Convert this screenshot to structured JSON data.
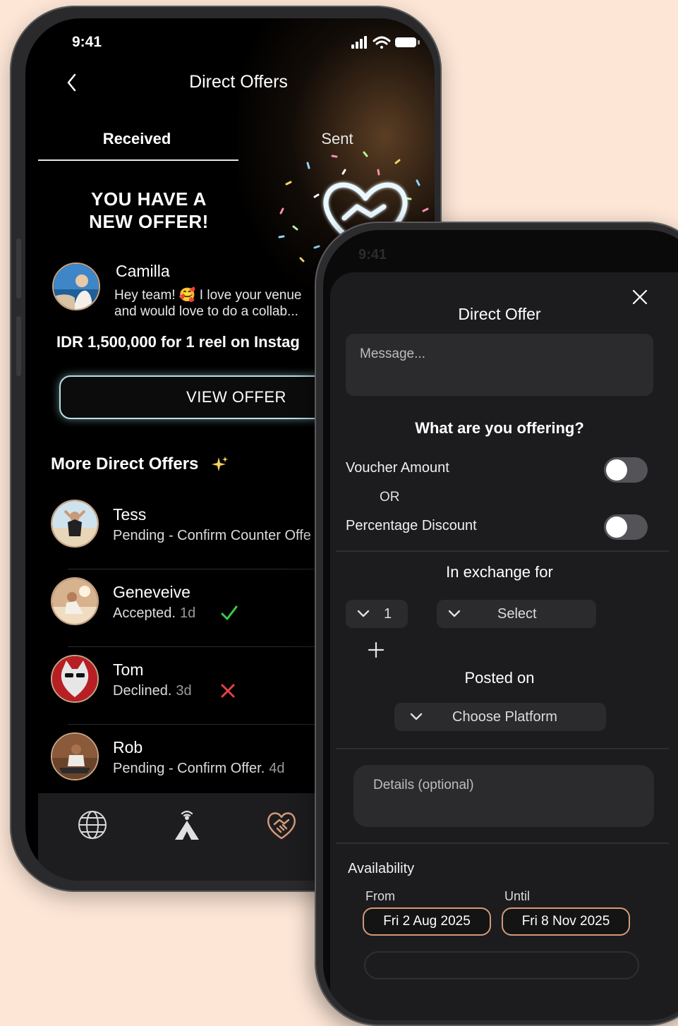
{
  "colors": {
    "accent": "#d3997a",
    "toggle_off": "#545458",
    "sheet_bg": "#1c1c1e",
    "danger": "#e54343",
    "success": "#3ec94a"
  },
  "phone1": {
    "status_time": "9:41",
    "title": "Direct Offers",
    "tabs": [
      {
        "label": "Received",
        "active": true
      },
      {
        "label": "Sent",
        "active": false
      }
    ],
    "banner": {
      "line1": "YOU HAVE A",
      "line2": "NEW OFFER!"
    },
    "featured_offer": {
      "name": "Camilla",
      "message_line1": "Hey team! 🥰 I love your venue",
      "message_line2": "and would love to do a collab...",
      "price_text": "IDR 1,500,000 for 1 reel on Instag",
      "button_label": "VIEW OFFER"
    },
    "more_title": "More Direct Offers",
    "offers": [
      {
        "name": "Tess",
        "status": "Pending - Confirm Counter Offe",
        "age": "",
        "mark": "none"
      },
      {
        "name": "Geneveive",
        "status": "Accepted.",
        "age": "1d",
        "mark": "check"
      },
      {
        "name": "Tom",
        "status": "Declined.",
        "age": "3d",
        "mark": "cross"
      },
      {
        "name": "Rob",
        "status": "Pending - Confirm Offer.",
        "age": "4d",
        "mark": "none"
      }
    ],
    "tabbar_icons": [
      "globe-icon",
      "antenna-person-icon",
      "handshake-heart-icon"
    ]
  },
  "phone2": {
    "status_time": "9:41",
    "sheet_title": "Direct Offer",
    "message_placeholder": "Message...",
    "question": "What are you offering?",
    "voucher_label": "Voucher Amount",
    "voucher_on": false,
    "or_label": "OR",
    "percentage_label": "Percentage Discount",
    "percentage_on": false,
    "exchange_title": "In exchange for",
    "quantity_value": "1",
    "select_placeholder": "Select",
    "posted_title": "Posted on",
    "platform_placeholder": "Choose Platform",
    "details_placeholder": "Details (optional)",
    "availability_label": "Availability",
    "from_label": "From",
    "from_date": "Fri 2 Aug 2025",
    "until_label": "Until",
    "until_date": "Fri 8 Nov 2025"
  }
}
